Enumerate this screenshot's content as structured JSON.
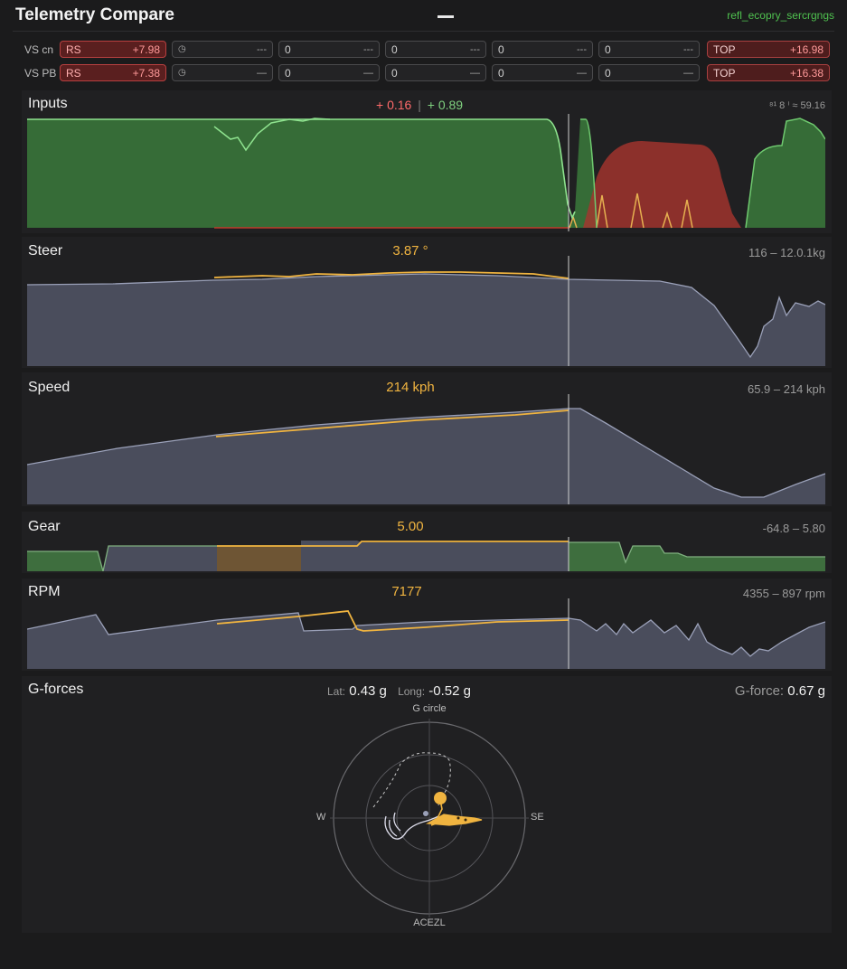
{
  "header": {
    "title": "Telemetry Compare",
    "link_text": "refl_ecopry_sercrgngs"
  },
  "compare_rows": [
    {
      "label": "VS cn",
      "rs_tag": "RS",
      "rs_value": "+7.98",
      "cells": [
        "---",
        "0",
        "---",
        "0",
        "---",
        "0",
        "---",
        "0",
        "---"
      ],
      "top_tag": "TOP",
      "top_value": "+16.98"
    },
    {
      "label": "VS PB",
      "rs_tag": "RS",
      "rs_value": "+7.38",
      "cells": [
        "—",
        "0",
        "—",
        "0",
        "—",
        "0",
        "—",
        "0",
        "—"
      ],
      "top_tag": "TOP",
      "top_value": "+16.38"
    }
  ],
  "panels": {
    "inputs": {
      "title": "Inputs",
      "delta_red": "+ 0.16",
      "sep": "|",
      "delta_green": "+ 0.89",
      "range": "⁸¹ 8  ⁱ ≈ 59.16"
    },
    "steer": {
      "title": "Steer",
      "value": "3.87 °",
      "range": "116 – 12.0.1kg"
    },
    "speed": {
      "title": "Speed",
      "value": "214 kph",
      "range": "65.9 – 214 kph"
    },
    "gear": {
      "title": "Gear",
      "value": "5.00",
      "range": "-64.8 – 5.80"
    },
    "rpm": {
      "title": "RPM",
      "value": "7177",
      "range": "4355 – 897 rpm"
    }
  },
  "gforces": {
    "title": "G-forces",
    "lat_label": "Lat:",
    "lat_value": "0.43 g",
    "long_label": "Long:",
    "long_value": "-0.52 g",
    "total_label": "G-force:",
    "total_value": "0.67 g",
    "circle_top": "G circle",
    "circle_bottom": "ACEZL",
    "circle_left": "W",
    "circle_right": "SE"
  },
  "colors": {
    "throttle": "#3f8f3f",
    "brake": "#b33a32",
    "compare_line": "#f0b440",
    "reference_fill": "#4a4d5c",
    "cursor": "#cfcfcf"
  }
}
